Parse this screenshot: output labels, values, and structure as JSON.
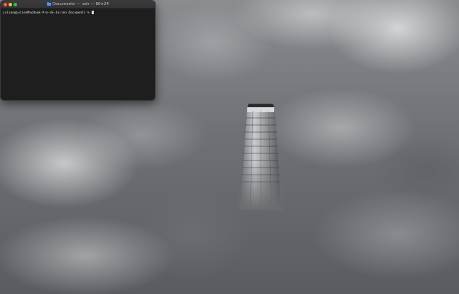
{
  "terminal": {
    "title": "Documents — -zsh — 80×24",
    "folder_icon": "folder-icon",
    "prompt": "julien@julienMacBook-Pro-de-Julien Documents % ",
    "traffic_colors": {
      "close": "#ff5f57",
      "minimize": "#febc2e",
      "maximize": "#28c840"
    }
  },
  "desktop": {
    "wallpaper": "tower-above-clouds"
  }
}
